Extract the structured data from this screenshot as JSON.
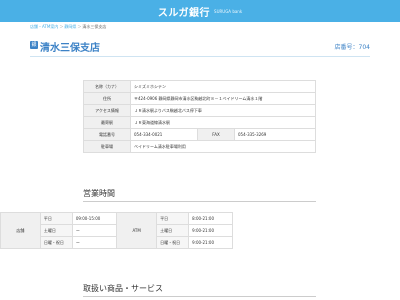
{
  "header": {
    "brand": "スルガ銀行",
    "brand_sub": "SURUGA bank"
  },
  "breadcrumb": {
    "items": [
      "店舗・ATM案内",
      "静岡県"
    ],
    "current": "清水三保支店"
  },
  "title": {
    "icon": "銀",
    "name": "清水三保支店",
    "store_no": "店番号：704"
  },
  "info": {
    "rows": [
      {
        "label": "名称（カナ）",
        "value": "シミズミホシテン"
      },
      {
        "label": "住所",
        "value": "〒424-0906 静岡県静岡市清水区駒越北町８－１ベイドリーム清水１階"
      },
      {
        "label": "アクセス情報",
        "value": "ＪＲ清水駅よりバス駒越北バス停下車"
      },
      {
        "label": "最寄駅",
        "value": "ＪＲ東海道線清水駅"
      }
    ],
    "phone_label": "電話番号",
    "phone": "054-334-0021",
    "fax_label": "FAX",
    "fax": "054-335-3269",
    "parking_label": "駐車場",
    "parking": "ベイドリーム清水駐車場利用"
  },
  "hours": {
    "title": "営業時間",
    "store_label": "店舗",
    "atm_label": "ATM",
    "rows": [
      {
        "day": "平日",
        "store": "09:00-15:00",
        "atm": "8:00-21:00"
      },
      {
        "day": "土曜日",
        "store": "ー",
        "atm": "9:00-21:00"
      },
      {
        "day": "日曜・祝日",
        "store": "ー",
        "atm": "9:00-21:00"
      }
    ]
  },
  "services": {
    "title": "取扱い商品・サービス"
  },
  "colors": {
    "header": "#4ab0e6",
    "accent": "#3c82c6"
  }
}
